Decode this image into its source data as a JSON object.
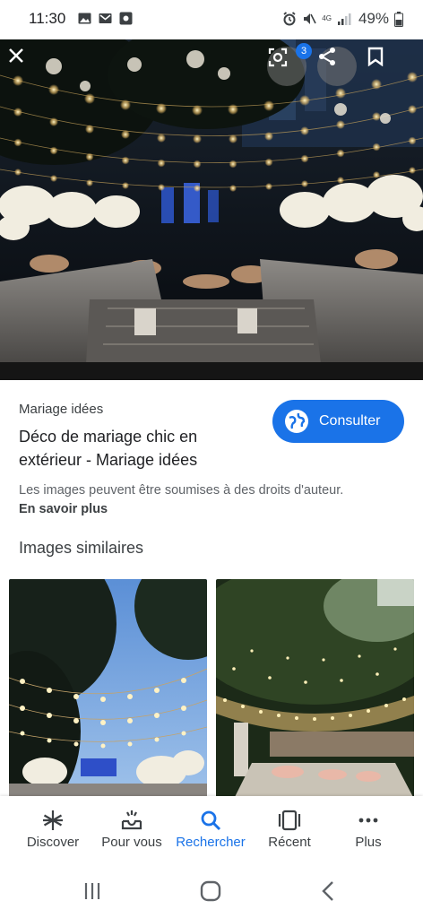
{
  "status_bar": {
    "time": "11:30",
    "battery": "49%",
    "network": "4G",
    "icons": [
      "gallery-icon",
      "gmail-icon",
      "app-icon",
      "alarm-icon",
      "mute-icon",
      "signal-icon",
      "battery-icon"
    ]
  },
  "hero": {
    "lens_badge": "3",
    "icons": [
      "close-icon",
      "lens-icon",
      "share-icon",
      "bookmark-icon"
    ]
  },
  "result": {
    "source": "Mariage idées",
    "title": "Déco de mariage chic en extérieur - Mariage idées",
    "consult_label": "Consulter",
    "copyright": "Les images peuvent être soumises à des droits d'auteur.",
    "learn_more": "En savoir plus"
  },
  "similar": {
    "heading": "Images similaires"
  },
  "bottom_nav": {
    "items": [
      {
        "label": "Discover",
        "icon": "asterisk-icon"
      },
      {
        "label": "Pour vous",
        "icon": "inbox-icon"
      },
      {
        "label": "Rechercher",
        "icon": "search-icon"
      },
      {
        "label": "Récent",
        "icon": "recent-tabs-icon"
      },
      {
        "label": "Plus",
        "icon": "more-icon"
      }
    ],
    "active": "Rechercher"
  },
  "colors": {
    "accent": "#1a73e8",
    "text": "#202124",
    "muted": "#5f6368"
  }
}
